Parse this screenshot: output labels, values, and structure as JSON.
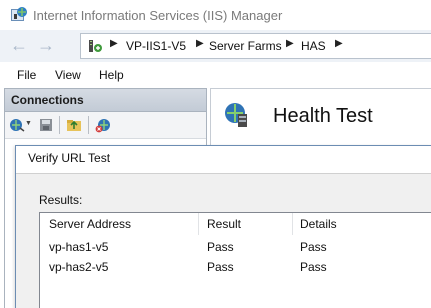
{
  "window": {
    "title": "Internet Information Services (IIS) Manager"
  },
  "navigation": {
    "breadcrumbs": [
      "VP-IIS1-V5",
      "Server Farms",
      "HAS"
    ]
  },
  "menu": {
    "items": [
      "File",
      "View",
      "Help"
    ]
  },
  "connections": {
    "title": "Connections",
    "toolbar_icons": [
      "connect-icon",
      "save-icon",
      "up-folder-icon",
      "disconnect-icon"
    ]
  },
  "feature": {
    "title": "Health Test"
  },
  "dialog": {
    "title": "Verify URL Test",
    "results_label": "Results:",
    "columns": [
      "Server Address",
      "Result",
      "Details"
    ],
    "rows": [
      [
        "vp-has1-v5",
        "Pass",
        "Pass"
      ],
      [
        "vp-has2-v5",
        "Pass",
        "Pass"
      ]
    ]
  }
}
